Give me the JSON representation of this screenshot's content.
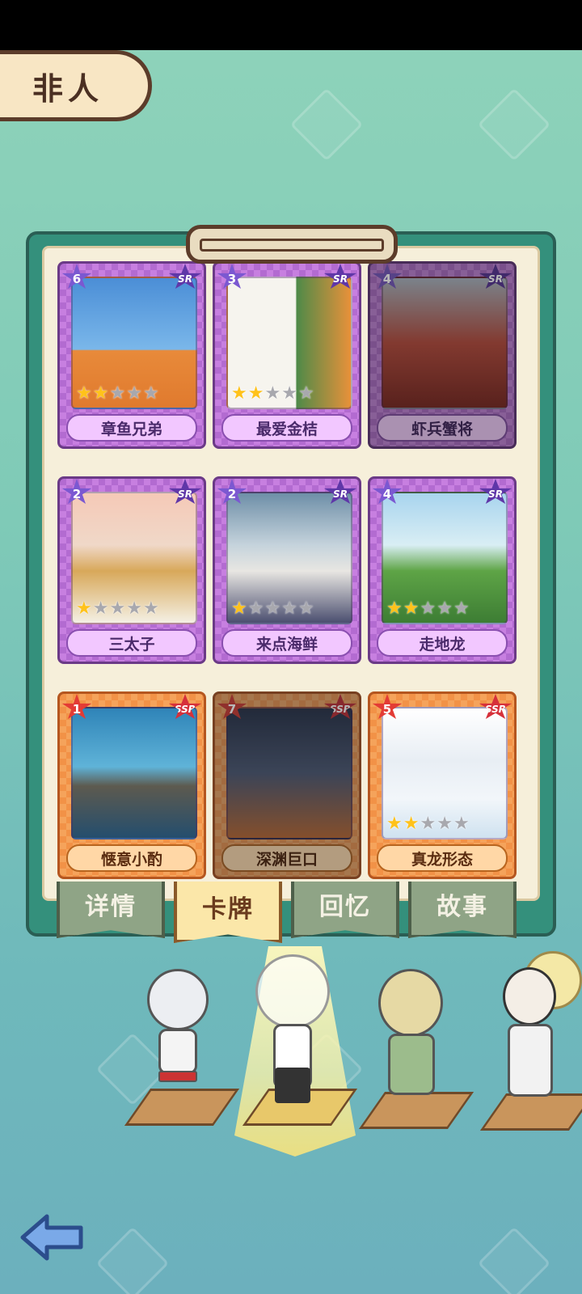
{
  "category_tab": {
    "label": "非人"
  },
  "cards": [
    {
      "name": "章鱼兄弟",
      "count": "6",
      "rarity": "SR",
      "stars": 2,
      "dim": false
    },
    {
      "name": "最爱金桔",
      "count": "3",
      "rarity": "SR",
      "stars": 2,
      "dim": false
    },
    {
      "name": "虾兵蟹将",
      "count": "4",
      "rarity": "SR",
      "stars": 0,
      "dim": true
    },
    {
      "name": "三太子",
      "count": "2",
      "rarity": "SR",
      "stars": 1,
      "dim": false
    },
    {
      "name": "来点海鲜",
      "count": "2",
      "rarity": "SR",
      "stars": 1,
      "dim": false
    },
    {
      "name": "走地龙",
      "count": "4",
      "rarity": "SR",
      "stars": 2,
      "dim": false
    },
    {
      "name": "惬意小酌",
      "count": "1",
      "rarity": "SSR",
      "stars": 0,
      "dim": false
    },
    {
      "name": "深渊巨口",
      "count": "7",
      "rarity": "SSR",
      "stars": 0,
      "dim": true
    },
    {
      "name": "真龙形态",
      "count": "5",
      "rarity": "SSR",
      "stars": 2,
      "dim": false
    }
  ],
  "bottom_tabs": [
    {
      "label": "详情",
      "active": false
    },
    {
      "label": "卡牌",
      "active": true
    },
    {
      "label": "回忆",
      "active": false
    },
    {
      "label": "故事",
      "active": false
    }
  ],
  "icons": {
    "back": "back-arrow-icon",
    "star": "star-icon"
  },
  "colors": {
    "sr_frame": "#c77fe0",
    "ssr_frame": "#f5a35b",
    "star_filled": "#ffc21a",
    "star_empty": "#a8a8ae",
    "active_tab": "#fbe7a9",
    "board": "#34907c"
  }
}
